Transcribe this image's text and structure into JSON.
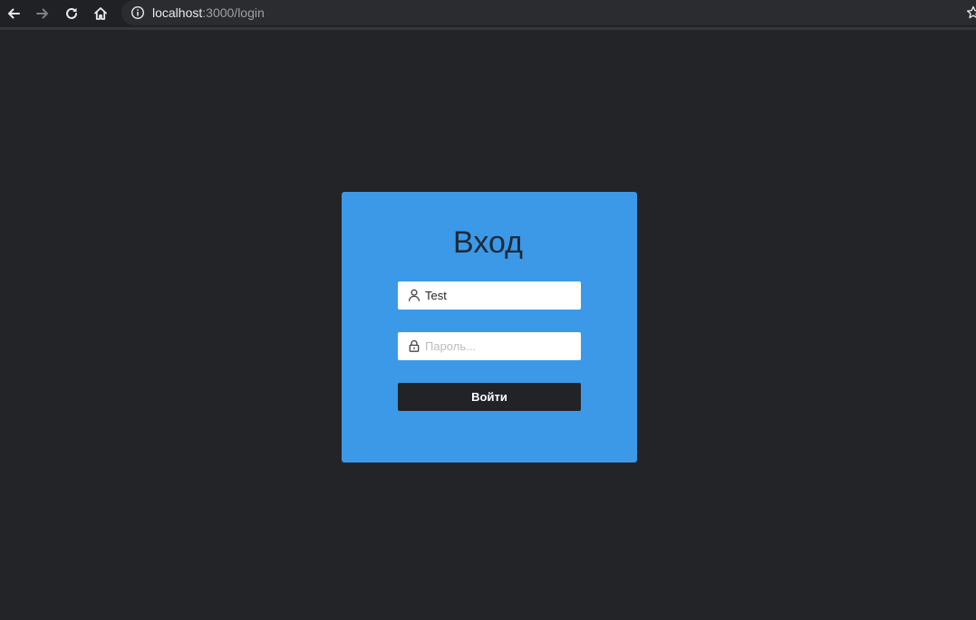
{
  "browser": {
    "url_host": "localhost",
    "url_rest": ":3000/login"
  },
  "login": {
    "title": "Вход",
    "username": {
      "value": "Test",
      "icon": "user-icon"
    },
    "password": {
      "value": "",
      "placeholder": "Пароль...",
      "icon": "lock-icon"
    },
    "submit_label": "Войти"
  },
  "colors": {
    "page_background": "#232428",
    "card_background": "#3b99e8",
    "button_background": "#222326",
    "title_color": "#1d2a38"
  }
}
